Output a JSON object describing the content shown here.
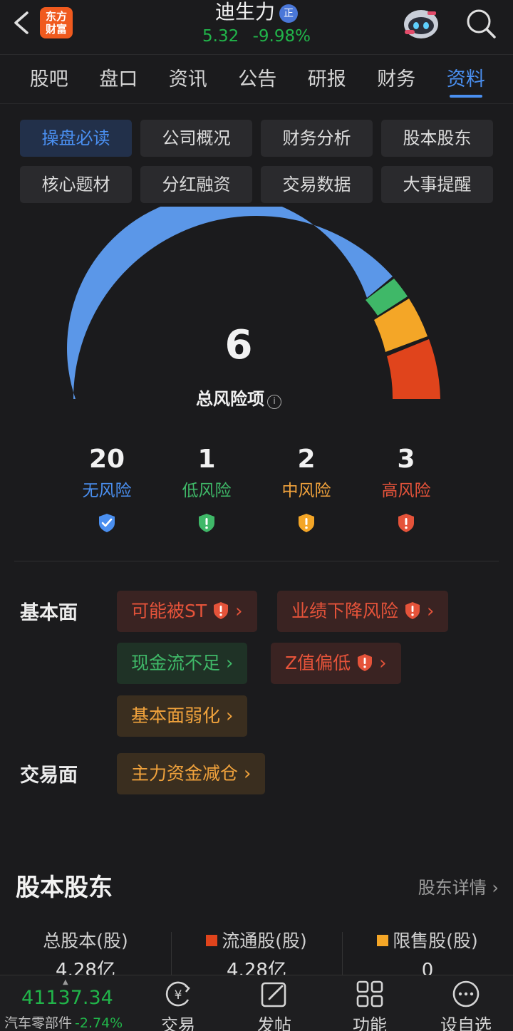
{
  "header": {
    "logo_line1": "东方",
    "logo_line2": "财富",
    "stock_name": "迪生力",
    "badge": "正",
    "price": "5.32",
    "change_pct": "-9.98%"
  },
  "tabs": [
    {
      "label": "股吧"
    },
    {
      "label": "盘口"
    },
    {
      "label": "资讯"
    },
    {
      "label": "公告"
    },
    {
      "label": "研报"
    },
    {
      "label": "财务"
    },
    {
      "label": "资料",
      "active": true
    }
  ],
  "subtabs": [
    {
      "label": "操盘必读",
      "active": true
    },
    {
      "label": "公司概况"
    },
    {
      "label": "财务分析"
    },
    {
      "label": "股本股东"
    },
    {
      "label": "核心题材"
    },
    {
      "label": "分红融资"
    },
    {
      "label": "交易数据"
    },
    {
      "label": "大事提醒"
    }
  ],
  "risk": {
    "total": "6",
    "total_label": "总风险项",
    "levels": [
      {
        "count": "20",
        "label": "无风险",
        "color": "#4a8ff0"
      },
      {
        "count": "1",
        "label": "低风险",
        "color": "#3fb868"
      },
      {
        "count": "2",
        "label": "中风险",
        "color": "#f0a23c"
      },
      {
        "count": "3",
        "label": "高风险",
        "color": "#e5533a"
      }
    ],
    "gauge_colors": {
      "none": "#5b97e8",
      "low": "#3fb868",
      "mid": "#f4a627",
      "high": "#e0441c"
    }
  },
  "fundamentals": {
    "title": "基本面",
    "tags": [
      "可能被ST",
      "业绩下降风险",
      "现金流不足",
      "Z值偏低",
      "基本面弱化"
    ]
  },
  "trading": {
    "title": "交易面",
    "tags": [
      "主力资金减仓"
    ]
  },
  "shareholders": {
    "title": "股本股东",
    "link": "股东详情",
    "cols": [
      {
        "head": "总股本(股)",
        "value": "4.28亿"
      },
      {
        "head": "流通股(股)",
        "value": "4.28亿",
        "color": "#e0441c"
      },
      {
        "head": "限售股(股)",
        "value": "0",
        "color": "#f4a627"
      }
    ]
  },
  "bottom": {
    "index_value": "41137.34",
    "index_name": "汽车零部件",
    "index_change": "-2.74%",
    "nav": [
      {
        "label": "交易",
        "icon": "yen-circle-icon"
      },
      {
        "label": "发帖",
        "icon": "edit-icon"
      },
      {
        "label": "功能",
        "icon": "grid-icon"
      },
      {
        "label": "设自选",
        "icon": "more-circle-icon"
      }
    ]
  }
}
